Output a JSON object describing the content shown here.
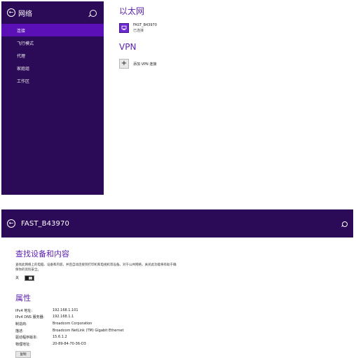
{
  "top_panel": {
    "sidebar": {
      "title": "网络",
      "items": [
        {
          "label": "连接",
          "active": true
        },
        {
          "label": "飞行模式",
          "active": false
        },
        {
          "label": "代理",
          "active": false
        },
        {
          "label": "家庭组",
          "active": false
        },
        {
          "label": "工作区",
          "active": false
        }
      ]
    },
    "ethernet_heading": "以太网",
    "network": {
      "name": "FAST_B43970",
      "status": "已连接"
    },
    "vpn_heading": "VPN",
    "vpn_add_label": "添加 VPN 连接"
  },
  "bottom_panel": {
    "header_title": "FAST_B43970",
    "discover": {
      "title": "查找设备和内容",
      "description": "查找此网络上的电脑、设备和内容，并且自动连接到打印机和电视机等设备。对于公共网络，关闭此功能将有助于确保你的资料安全。",
      "toggle_label": "关"
    },
    "properties": {
      "title": "属性",
      "rows": [
        {
          "key": "IPv4 地址:",
          "value": "192.168.1.101"
        },
        {
          "key": "IPv4 DNS 服务器:",
          "value": "192.168.1.1"
        },
        {
          "key": "制造商:",
          "value": "Broadcom Corporation"
        },
        {
          "key": "描述:",
          "value": "Broadcom NetLink (TM) Gigabit Ethernet"
        },
        {
          "key": "驱动程序版本:",
          "value": "15.6.1.2"
        },
        {
          "key": "物理地址:",
          "value": "20-89-84-70-36-D3"
        }
      ],
      "copy_label": "复制"
    }
  },
  "colors": {
    "sidebar_bg": "#2b0a57",
    "active_bg": "#5a0fb7",
    "accent": "#5a1fb0"
  },
  "icons": [
    "back-arrow-icon",
    "search-icon",
    "network-icon",
    "plus-icon"
  ]
}
